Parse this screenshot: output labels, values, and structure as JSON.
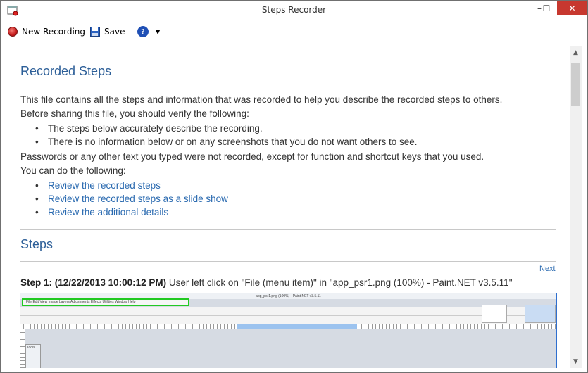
{
  "window": {
    "title": "Steps Recorder",
    "controls": {
      "minimize": "–",
      "maximize": "☐",
      "close": "✕"
    }
  },
  "toolbar": {
    "new_recording": "New Recording",
    "save": "Save",
    "help": "?",
    "dropdown": "▼"
  },
  "recorded_steps": {
    "heading": "Recorded Steps",
    "intro": "This file contains all the steps and information that was recorded to help you describe the recorded steps to others.",
    "verify_intro": "Before sharing this file, you should verify the following:",
    "verify_items": [
      "The steps below accurately describe the recording.",
      "There is no information below or on any screenshots that you do not want others to see."
    ],
    "passwords_note": "Passwords or any other text you typed were not recorded, except for function and shortcut keys that you used.",
    "can_do": "You can do the following:",
    "links": [
      "Review the recorded steps",
      "Review the recorded steps as a slide show",
      "Review the additional details"
    ]
  },
  "steps": {
    "heading": "Steps",
    "next_link": "Next",
    "step1_label": "Step 1: (12/22/2013 10:00:12 PM)",
    "step1_text": " User left click on \"File (menu item)\" in \"app_psr1.png (100%) - Paint.NET v3.5.11\""
  },
  "screenshot": {
    "title": "app_psr1.png (100%) - Paint.NET v3.5.11",
    "menu": "File   Edit   View   Image   Layers   Adjustments   Effects   Utilities   Window   Help",
    "tools_label": "Tools"
  },
  "colors": {
    "heading": "#2d5f98",
    "link": "#2a6ab0",
    "close_button": "#c7382f",
    "highlight_border": "#22c922"
  }
}
